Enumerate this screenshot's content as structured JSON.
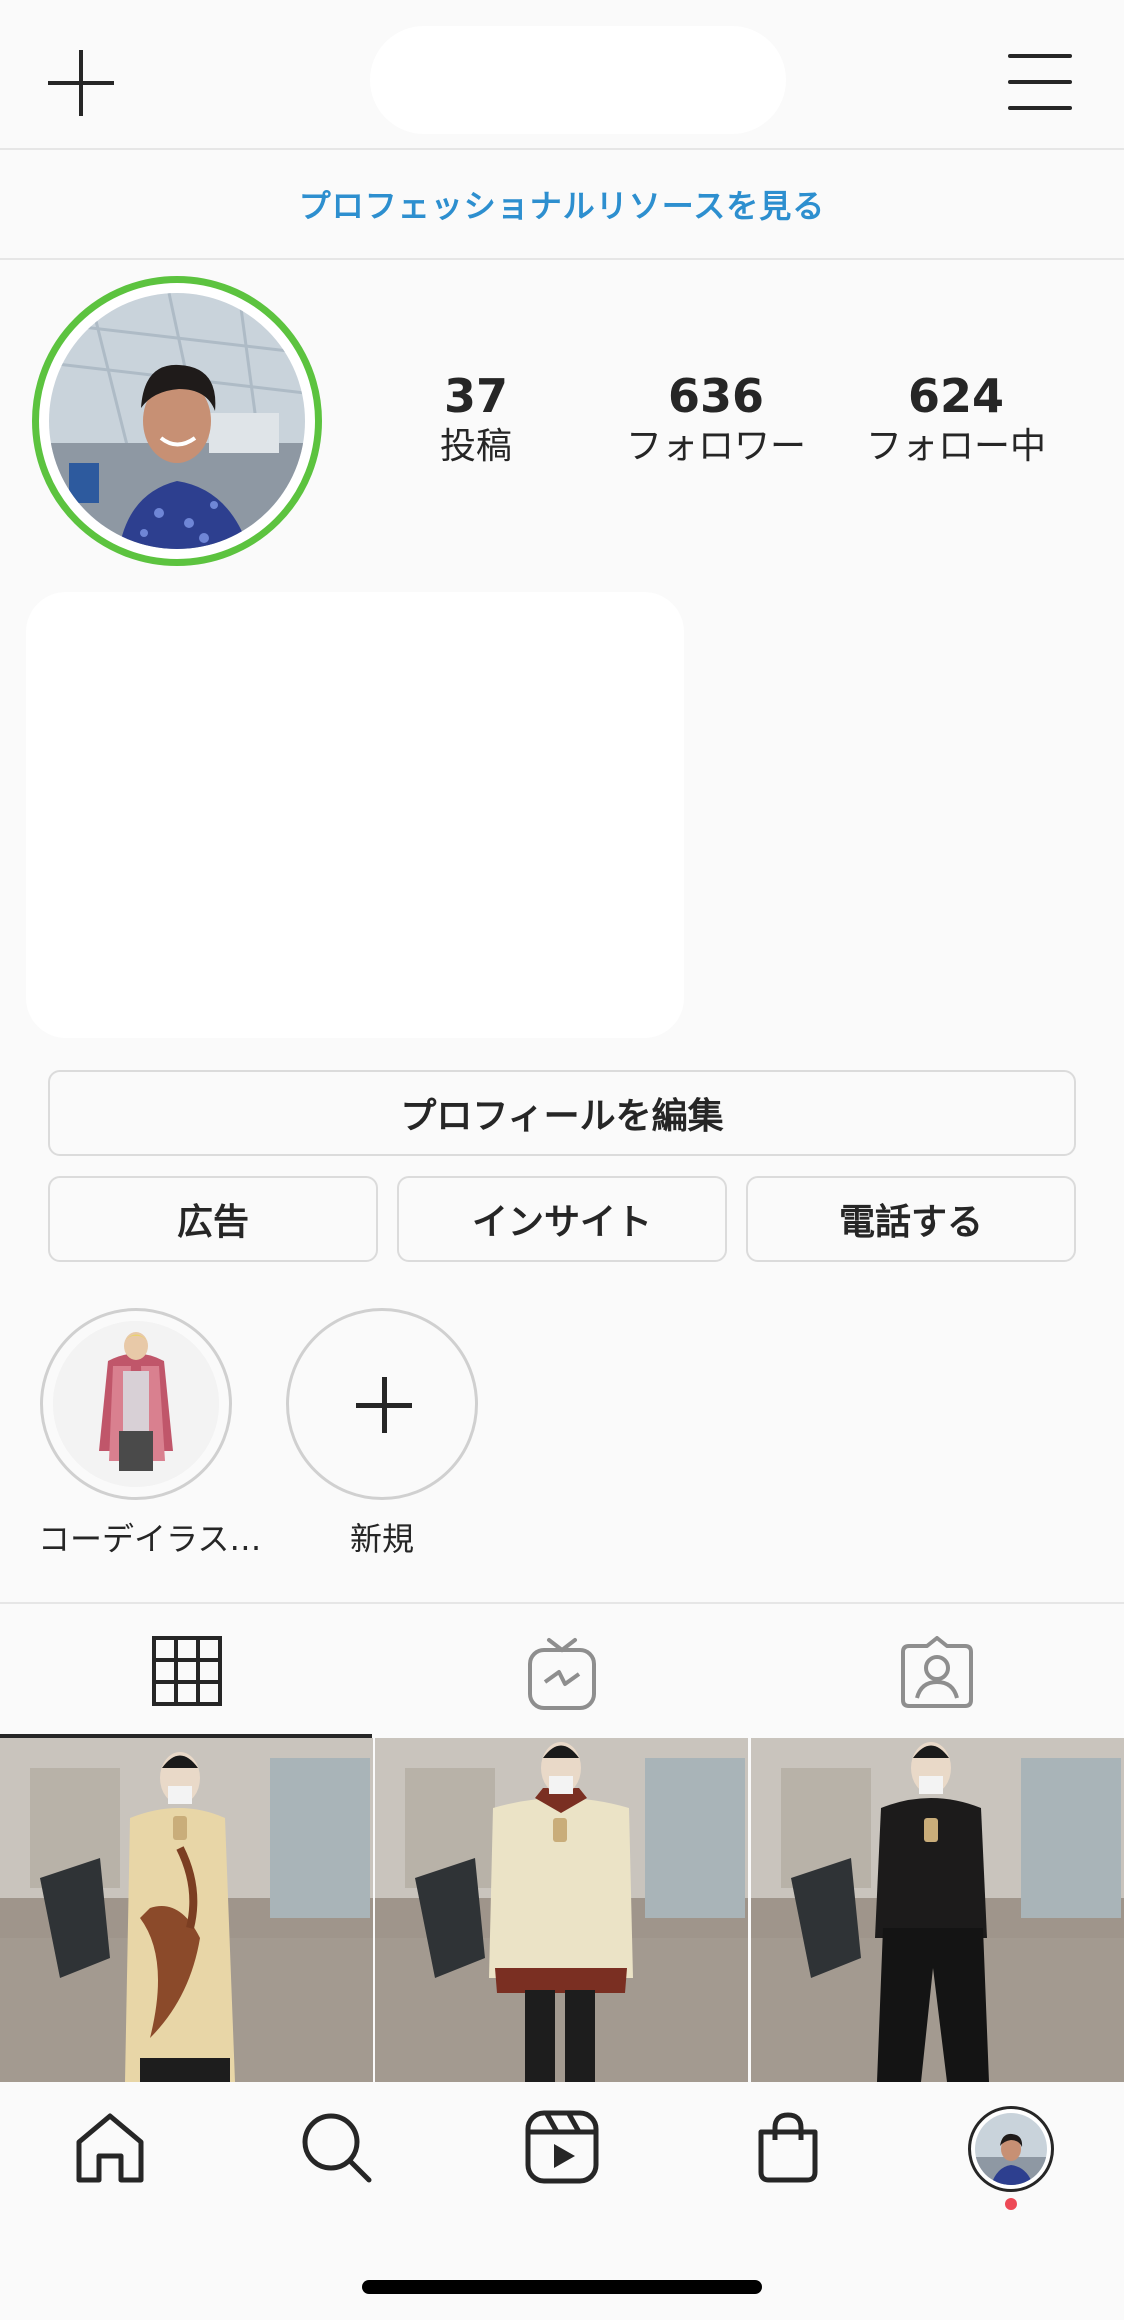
{
  "header": {
    "new_post_icon": "plus-icon",
    "username": "",
    "menu_icon": "hamburger-menu-icon"
  },
  "professional_link": "プロフェッショナルリソースを見る",
  "profile": {
    "ring_color": "#5cc33f",
    "stats": [
      {
        "count": "37",
        "label": "投稿"
      },
      {
        "count": "636",
        "label": "フォロワー"
      },
      {
        "count": "624",
        "label": "フォロー中"
      }
    ],
    "bio": ""
  },
  "buttons": {
    "edit_profile": "プロフィールを編集",
    "ads": "広告",
    "insights": "インサイト",
    "call": "電話する"
  },
  "highlights": [
    {
      "label": "コーデイラス…"
    },
    {
      "label": "新規"
    }
  ],
  "tabs": [
    {
      "name": "grid",
      "icon": "grid-icon",
      "active": true
    },
    {
      "name": "igtv",
      "icon": "igtv-icon",
      "active": false
    },
    {
      "name": "tagged",
      "icon": "tagged-user-icon",
      "active": false
    }
  ],
  "posts": [
    {
      "outfit": "long yellow graphic shirt"
    },
    {
      "outfit": "cream sweater with red shirt"
    },
    {
      "outfit": "black shirt and black trousers"
    }
  ],
  "bottom_nav": [
    {
      "icon": "home-icon"
    },
    {
      "icon": "search-icon"
    },
    {
      "icon": "reels-icon"
    },
    {
      "icon": "shop-bag-icon"
    },
    {
      "icon": "profile-avatar-icon"
    }
  ],
  "colors": {
    "link_blue": "#2d8fcf",
    "notification_dot": "#ed4956",
    "text": "#262626",
    "background": "#fafafa"
  }
}
